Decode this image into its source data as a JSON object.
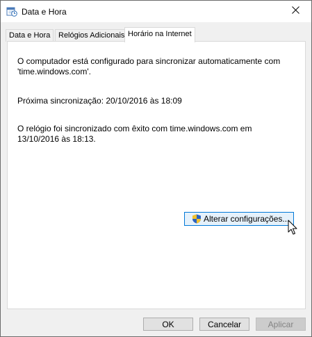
{
  "window": {
    "title": "Data e Hora",
    "app_icon": "calendar-clock-icon",
    "close_icon": "close-icon"
  },
  "tabs": [
    {
      "label": "Data e Hora",
      "active": false
    },
    {
      "label": "Relógios Adicionais",
      "active": false
    },
    {
      "label": "Horário na Internet",
      "active": true
    }
  ],
  "panel": {
    "sync_line1": "O computador está configurado para sincronizar automaticamente com",
    "sync_line2": "'time.windows.com'.",
    "next_sync": "Próxima sincronização: 20/10/2016 às 18:09",
    "last_sync_line1": "O relógio foi sincronizado com êxito com time.windows.com em",
    "last_sync_line2": "13/10/2016 às 18:13.",
    "change_button": "Alterar configurações...",
    "change_button_icon": "uac-shield-icon"
  },
  "footer": {
    "ok": "OK",
    "cancel": "Cancelar",
    "apply": "Aplicar"
  },
  "colors": {
    "accent": "#0078d7",
    "window_bg": "#f0f0f0"
  }
}
